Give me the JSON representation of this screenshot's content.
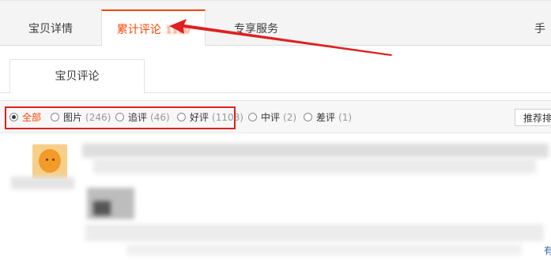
{
  "tabs": {
    "details": "宝贝详情",
    "reviews": "累计评论",
    "reviews_count": "1110",
    "services": "专享服务",
    "overflow": "手"
  },
  "subtab": {
    "label": "宝贝评论"
  },
  "filters": [
    {
      "label": "全部",
      "count": "",
      "selected": true
    },
    {
      "label": "图片",
      "count": "(246)",
      "selected": false
    },
    {
      "label": "追评",
      "count": "(46)",
      "selected": false
    },
    {
      "label": "好评",
      "count": "(1108)",
      "selected": false
    },
    {
      "label": "中评",
      "count": "(2)",
      "selected": false
    },
    {
      "label": "差评",
      "count": "(1)",
      "selected": false
    }
  ],
  "sort": {
    "label": "推荐排序"
  },
  "review": {
    "more": "有"
  },
  "colors": {
    "accent": "#ff4400",
    "annotation": "#e02020"
  },
  "icons": [
    "radio-checked-icon",
    "radio-unchecked-icon",
    "annotation-arrow-icon"
  ]
}
